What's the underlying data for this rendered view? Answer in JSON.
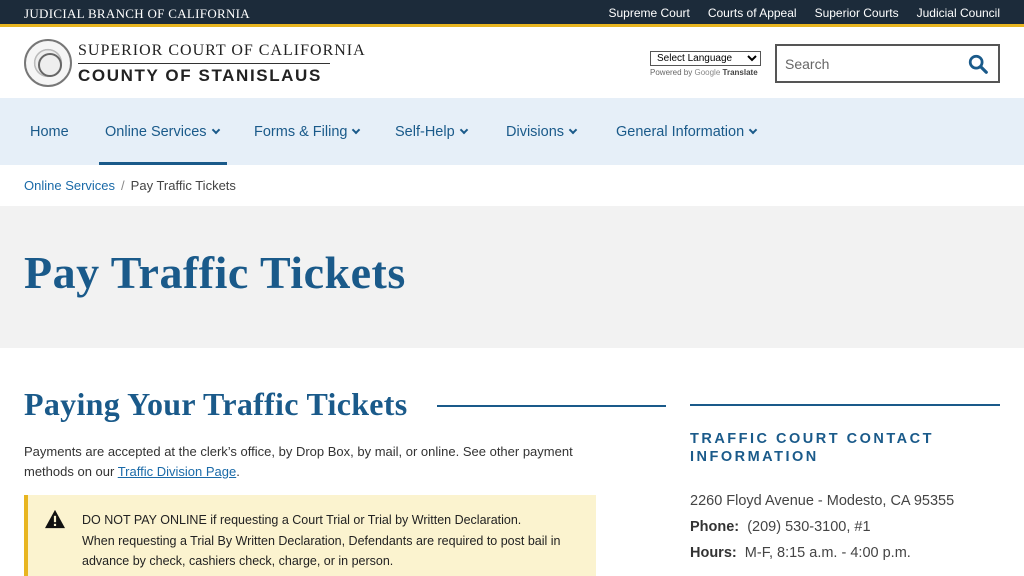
{
  "topbar": {
    "brand": "JUDICIAL BRANCH OF CALIFORNIA",
    "links": [
      "Supreme Court",
      "Courts of Appeal",
      "Superior Courts",
      "Judicial Council"
    ]
  },
  "header": {
    "court_line1": "SUPERIOR COURT OF CALIFORNIA",
    "court_line2": "COUNTY OF STANISLAUS",
    "language_select": "Select Language",
    "powered_by": "Powered by",
    "google": "Google",
    "translate": "Translate",
    "search_placeholder": "Search"
  },
  "nav": {
    "items": [
      {
        "label": "Home"
      },
      {
        "label": "Online Services"
      },
      {
        "label": "Forms & Filing"
      },
      {
        "label": "Self-Help"
      },
      {
        "label": "Divisions"
      },
      {
        "label": "General Information"
      }
    ]
  },
  "breadcrumb": {
    "parent": "Online Services",
    "separator": "/",
    "current": "Pay Traffic Tickets"
  },
  "page_title": "Pay Traffic Tickets",
  "main": {
    "section_title": "Paying Your Traffic Tickets",
    "intro_text": "Payments are accepted at the clerk’s office, by Drop Box, by mail, or online.   See other payment methods on our ",
    "intro_link": "Traffic Division Page",
    "intro_end": ".",
    "alert_line1": "DO NOT PAY ONLINE if requesting a Court Trial or Trial by Written Declaration.",
    "alert_line2": "When requesting a Trial By Written Declaration, Defendants are required to post bail in advance by check, cashiers check, charge, or in person."
  },
  "sidebar": {
    "title": "TRAFFIC COURT CONTACT INFORMATION",
    "address": "2260 Floyd Avenue - Modesto, CA 95355",
    "phone_label": "Phone:",
    "phone": "(209) 530-3100, #1",
    "hours_label": "Hours:",
    "hours": "M-F, 8:15 a.m. - 4:00 p.m."
  },
  "colors": {
    "topbar_bg": "#1c2b3a",
    "accent_gold": "#e8b520",
    "brand_blue": "#1a5a8a",
    "nav_bg": "#e6eff8",
    "alert_bg": "#fbf3cf"
  }
}
